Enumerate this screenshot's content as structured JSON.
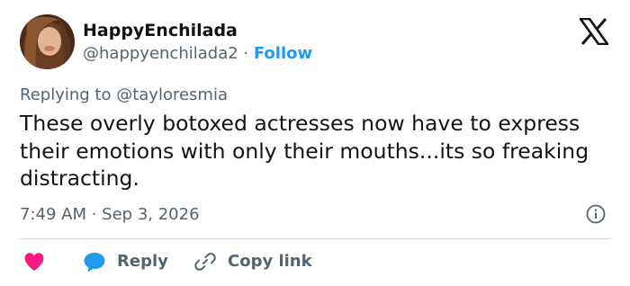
{
  "user": {
    "display_name": "HappyEnchilada",
    "handle": "@happyenchilada2",
    "separator": " · ",
    "follow_label": "Follow"
  },
  "reply_context": {
    "prefix": "Replying to ",
    "target": "@tayloresmia"
  },
  "tweet": {
    "text": "These overly botoxed actresses now have to express their emotions with only their mouths...its so freaking distracting.",
    "time": "7:49 AM",
    "date_separator": " · ",
    "date": "Sep 3, 2026"
  },
  "actions": {
    "reply_label": "Reply",
    "copy_link_label": "Copy link"
  },
  "colors": {
    "accent": "#1d9bf0",
    "like": "#f91880",
    "secondary_text": "#536471",
    "primary_text": "#0f1419",
    "divider": "#cfd9de"
  },
  "icons": {
    "brand": "x-logo-icon",
    "like": "heart-icon",
    "reply": "speech-bubble-icon",
    "copy_link": "link-icon",
    "info": "info-icon"
  }
}
